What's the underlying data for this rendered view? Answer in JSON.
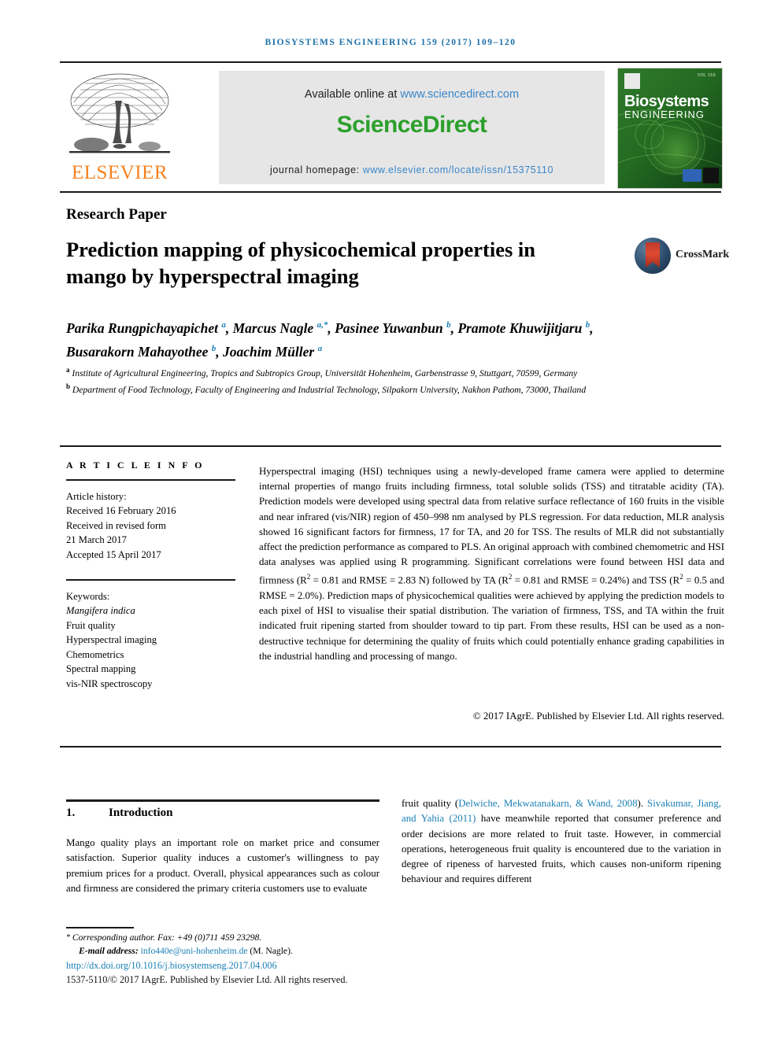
{
  "running_head": "BIOSYSTEMS ENGINEERING 159 (2017) 109–120",
  "masthead": {
    "elsevier_wordmark": "ELSEVIER",
    "available_online_prefix": "Available online at ",
    "available_online_link": "www.sciencedirect.com",
    "sciencedirect_logo": "ScienceDirect",
    "homepage_prefix": "journal homepage: ",
    "homepage_link": "www.elsevier.com/locate/issn/15375110",
    "cover": {
      "title_line1": "Biosystems",
      "title_line2": "ENGINEERING",
      "issue_text": "VOL 159"
    },
    "colors": {
      "elsevier_orange": "#f58220",
      "sciencedirect_green": "#2ca02c",
      "link_blue": "#3a86c8",
      "band_grey": "#e6e6e6",
      "cover_green": "#1d5c1d"
    }
  },
  "article": {
    "section_type": "Research Paper",
    "title": "Prediction mapping of physicochemical properties in mango by hyperspectral imaging",
    "crossmark_label": "CrossMark",
    "authors_html": "Parika Rungpichayapichet <sup>a</sup>, Marcus Nagle <sup>a,*</sup>, Pasinee Yuwanbun <sup>b</sup>, Pramote Khuwijitjaru <sup>b</sup>, Busarakorn Mahayothee <sup>b</sup>, Joachim Müller <sup>a</sup>",
    "affiliation_a": "Institute of Agricultural Engineering, Tropics and Subtropics Group, Universität Hohenheim, Garbenstrasse 9, Stuttgart, 70599, Germany",
    "affiliation_b": "Department of Food Technology, Faculty of Engineering and Industrial Technology, Silpakorn University, Nakhon Pathom, 73000, Thailand"
  },
  "article_info": {
    "heading": "A R T I C L E  I N F O",
    "history_label": "Article history:",
    "received": "Received 16 February 2016",
    "revised_label": "Received in revised form",
    "revised_date": "21 March 2017",
    "accepted": "Accepted 15 April 2017",
    "keywords_label": "Keywords:",
    "keywords": [
      "Mangifera indica",
      "Fruit quality",
      "Hyperspectral imaging",
      "Chemometrics",
      "Spectral mapping",
      "vis-NIR spectroscopy"
    ]
  },
  "abstract": {
    "text_html": "Hyperspectral imaging (HSI) techniques using a newly-developed frame camera were applied to determine internal properties of mango fruits including firmness, total soluble solids (TSS) and titratable acidity (TA). Prediction models were developed using spectral data from relative surface reflectance of 160 fruits in the visible and near infrared (vis/NIR) region of 450&ndash;998&nbsp;nm analysed by PLS regression. For data reduction, MLR analysis showed 16 significant factors for firmness, 17 for TA, and 20 for TSS. The results of MLR did not substantially affect the prediction performance as compared to PLS. An original approach with combined chemometric and HSI data analyses was applied using R programming. Significant correlations were found between HSI data and firmness (R<sup>2</sup> = 0.81 and RMSE = 2.83 N) followed by TA (R<sup>2</sup> = 0.81 and RMSE = 0.24%) and TSS (R<sup>2</sup> = 0.5 and RMSE = 2.0%). Prediction maps of physicochemical qualities were achieved by applying the prediction models to each pixel of HSI to visualise their spatial distribution. The variation of firmness, TSS, and TA within the fruit indicated fruit ripening started from shoulder toward to tip part. From these results, HSI can be used as a non-destructive technique for determining the quality of fruits which could potentially enhance grading capabilities in the industrial handling and processing of mango.",
    "copyright": "© 2017 IAgrE. Published by Elsevier Ltd. All rights reserved."
  },
  "introduction": {
    "number": "1.",
    "title": "Introduction",
    "left_column": "Mango quality plays an important role on market price and consumer satisfaction. Superior quality induces a customer's willingness to pay premium prices for a product. Overall, physical appearances such as colour and firmness are considered the primary criteria customers use to evaluate",
    "right_column_html": "fruit quality (<span class=\"cite\">Delwiche, Mekwatanakarn, &amp; Wand, 2008</span>). <span class=\"cite\">Sivakumar, Jiang, and Yahia (2011)</span> have meanwhile reported that consumer preference and order decisions are more related to fruit taste. However, in commercial operations, heterogeneous fruit quality is encountered due to the variation in degree of ripeness of harvested fruits, which causes non-uniform ripening behaviour and requires different"
  },
  "footnote": {
    "corresponding": "Corresponding author. Fax: +49 (0)711 459 23298.",
    "email_label": "E-mail address:",
    "email": "info440e@uni-hohenheim.de",
    "email_owner": "(M. Nagle).",
    "doi": "http://dx.doi.org/10.1016/j.biosystemseng.2017.04.006",
    "issn_line": "1537-5110/© 2017 IAgrE. Published by Elsevier Ltd. All rights reserved."
  }
}
